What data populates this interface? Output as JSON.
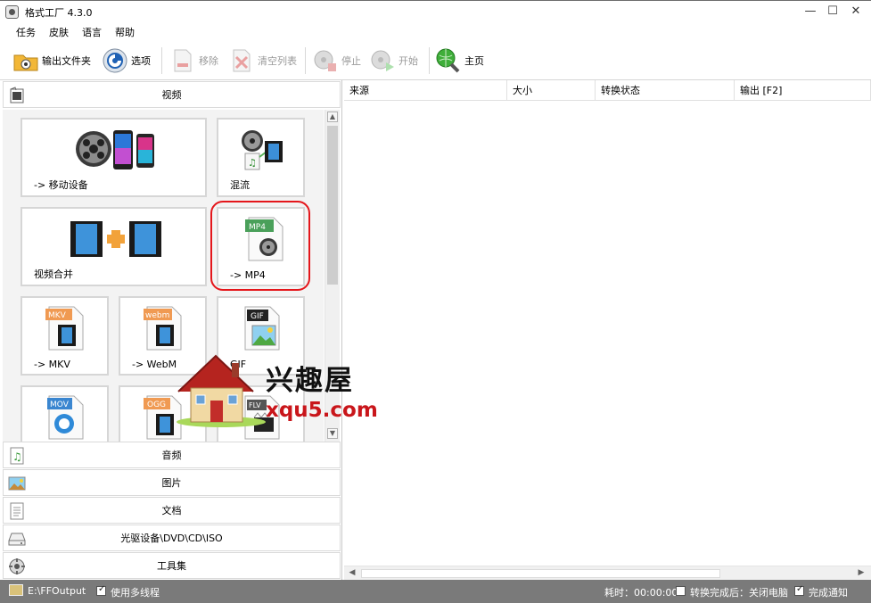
{
  "window": {
    "title": "格式工厂 4.3.0",
    "minimize": "—",
    "maximize": "☐",
    "close": "✕"
  },
  "menu": [
    "任务",
    "皮肤",
    "语言",
    "帮助"
  ],
  "toolbar": {
    "output_folder": "输出文件夹",
    "options": "选项",
    "remove": "移除",
    "clear_list": "清空列表",
    "stop": "停止",
    "start": "开始",
    "home": "主页"
  },
  "categories": {
    "video": "视频",
    "audio": "音频",
    "image": "图片",
    "document": "文档",
    "optical": "光驱设备\\DVD\\CD\\ISO",
    "tools": "工具集"
  },
  "tiles": {
    "mobile": "-> 移动设备",
    "mux": "混流",
    "join": "视频合并",
    "mp4": "-> MP4",
    "mkv": "-> MKV",
    "webm": "-> WebM",
    "gif": "GIF",
    "mp4_badge": "MP4",
    "mkv_badge": "MKV",
    "webm_badge": "webm",
    "gif_badge": "GIF",
    "mov_badge": "MOV",
    "ogg_badge": "OGG",
    "flv_badge": "FLV"
  },
  "columns": [
    "来源",
    "大小",
    "转换状态",
    "输出 [F2]"
  ],
  "status": {
    "output_path": "E:\\FFOutput",
    "multithread": "使用多线程",
    "multithread_checked": true,
    "elapsed": "耗时：00:00:00",
    "after_done": "转换完成后：关闭电脑",
    "after_done_checked": false,
    "notify": "完成通知",
    "notify_checked": true
  },
  "watermark": {
    "name": "兴趣屋",
    "url": "xqu5.com"
  },
  "colors": {
    "highlight": "#e4161b",
    "status_bar": "#7a7a7a",
    "watermark_url": "#c9161b"
  }
}
